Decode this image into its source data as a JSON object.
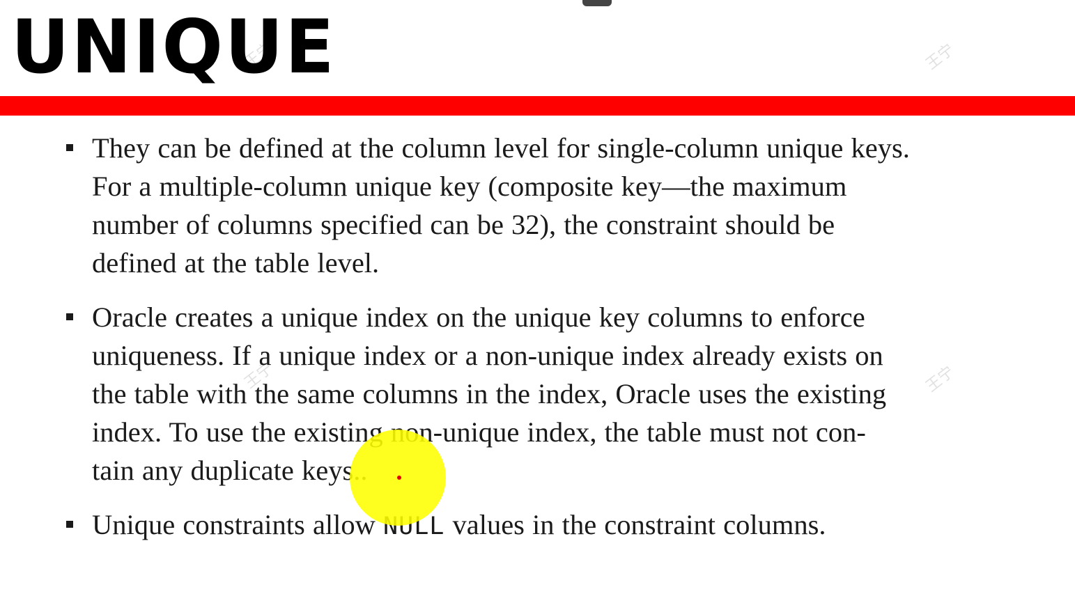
{
  "slide": {
    "title": "UNIQUE",
    "accent_color": "#ff0000"
  },
  "bullets": [
    {
      "lines": [
        "They can be defined at the column level for single-column unique keys.",
        "For a multiple-column unique key (composite key—the maximum",
        "number of columns specified can be 32), the constraint should be",
        "defined at the table level."
      ]
    },
    {
      "lines": [
        "Oracle creates a unique index on the unique key columns to enforce",
        "uniqueness. If a unique index or a non-unique index already exists on",
        "the table with the same columns in the index, Oracle uses the existing",
        "index. To use the existing non-unique index, the table must not con-",
        "tain any duplicate keys.."
      ]
    },
    {
      "before": "Unique constraints allow ",
      "code": "NULL",
      "after": " values in the constraint columns."
    }
  ],
  "watermark": "王宁",
  "pointer": {
    "highlight_color": "#ffff00"
  }
}
